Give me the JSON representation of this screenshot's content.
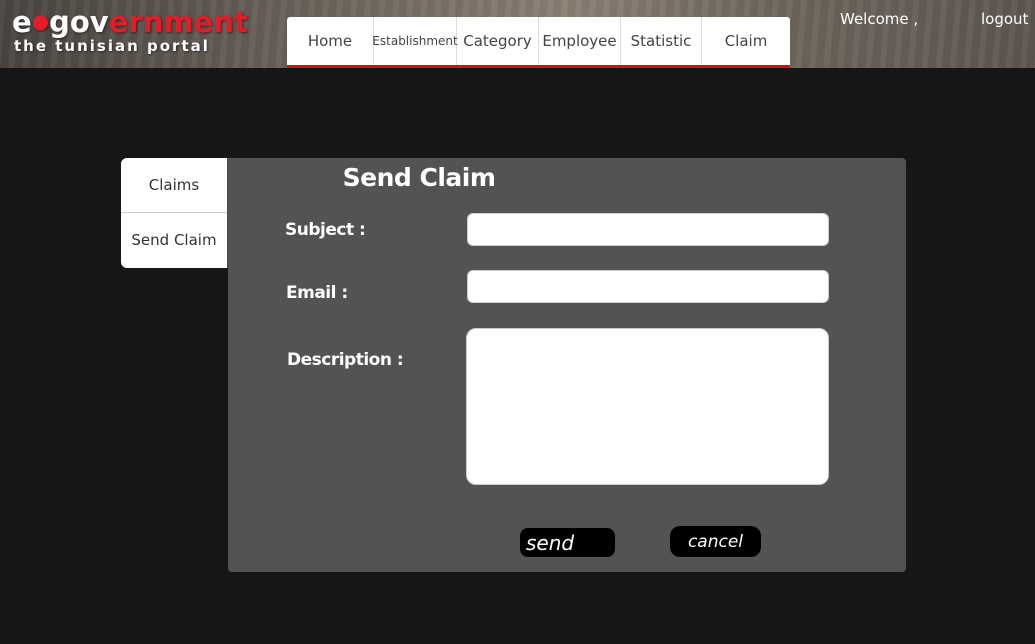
{
  "logo": {
    "brand_e": "e",
    "brand_gov": "gov",
    "brand_rest": "ernment",
    "tagline": "the tunisian portal"
  },
  "nav": {
    "items": [
      "Home",
      "Establishment",
      "Category",
      "Employee",
      "Statistic",
      "Claim"
    ]
  },
  "header": {
    "welcome": "Welcome ,",
    "logout": "logout"
  },
  "side_tabs": [
    "Claims",
    "Send Claim"
  ],
  "form": {
    "title": "Send Claim",
    "subject_label": "Subject :",
    "subject_value": "",
    "email_label": "Email :",
    "email_value": "",
    "description_label": "Description :",
    "description_value": "",
    "send_label": "send",
    "cancel_label": "cancel"
  },
  "colors": {
    "accent": "#c4161c",
    "background": "#161616",
    "panel": "#535353"
  }
}
